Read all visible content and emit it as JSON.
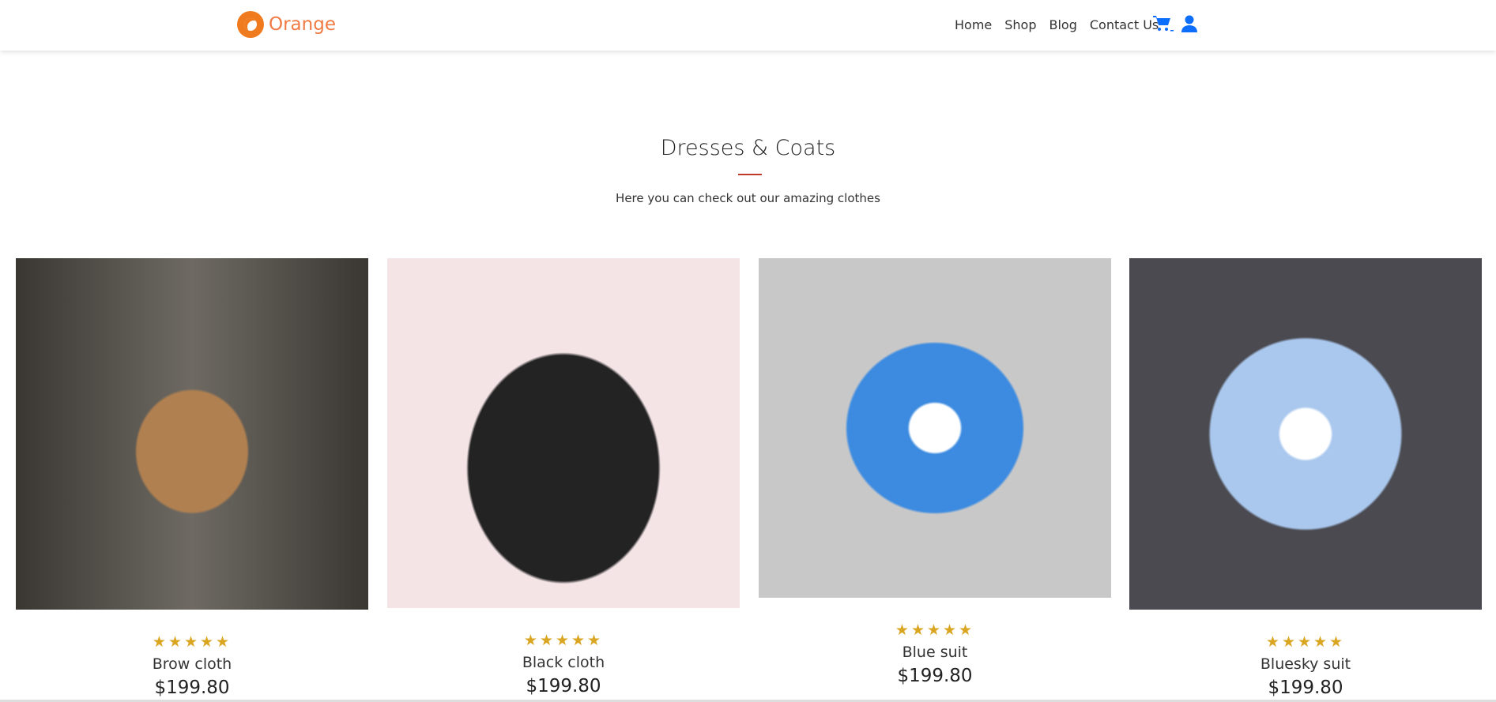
{
  "brand": {
    "name": "Orange",
    "color": "#f07a1e"
  },
  "nav": {
    "links": [
      "Home",
      "Shop",
      "Blog",
      "Contact Us"
    ],
    "icons": [
      "cart-icon",
      "user-icon"
    ],
    "accent": "#0d6efd"
  },
  "section": {
    "title": "Dresses & Coats",
    "subtitle": "Here you can check out our amazing clothes"
  },
  "products": [
    {
      "name": "Brow cloth",
      "price": "$199.80",
      "rating": 5,
      "stars": "★★★★★"
    },
    {
      "name": "Black cloth",
      "price": "$199.80",
      "rating": 5,
      "stars": "★★★★★"
    },
    {
      "name": "Blue suit",
      "price": "$199.80",
      "rating": 5,
      "stars": "★★★★★"
    },
    {
      "name": "Bluesky suit",
      "price": "$199.80",
      "rating": 5,
      "stars": "★★★★★"
    }
  ]
}
